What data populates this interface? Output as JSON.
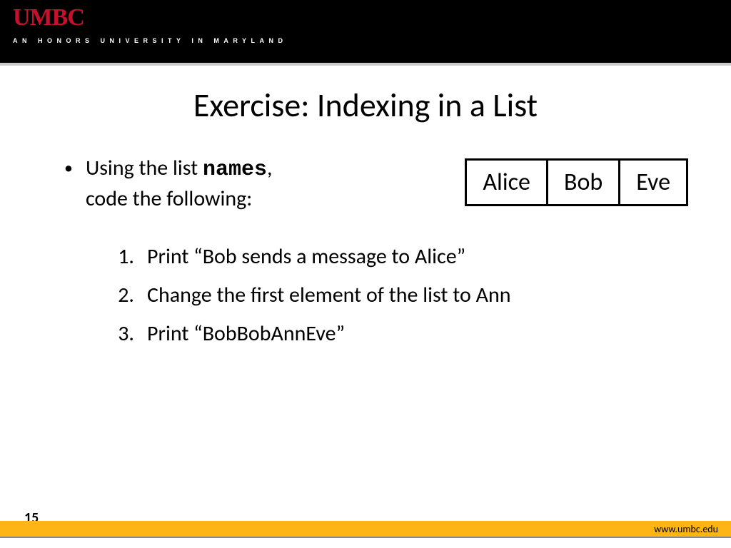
{
  "header": {
    "logo_text": "UMBC",
    "tagline": "AN HONORS UNIVERSITY IN MARYLAND"
  },
  "slide": {
    "title": "Exercise: Indexing in a List",
    "bullet_prefix": "Using the list ",
    "bullet_code": "names",
    "bullet_suffix": ",",
    "bullet_line2": "code the following:",
    "names": [
      "Alice",
      "Bob",
      "Eve"
    ],
    "items": [
      {
        "n": "1.",
        "text": "Print “Bob sends a message to Alice”"
      },
      {
        "n": "2.",
        "text": "Change the first element of the list to Ann"
      },
      {
        "n": "3.",
        "text": "Print “BobBobAnnEve”"
      }
    ],
    "number": "15"
  },
  "footer": {
    "url": "www.umbc.edu"
  }
}
